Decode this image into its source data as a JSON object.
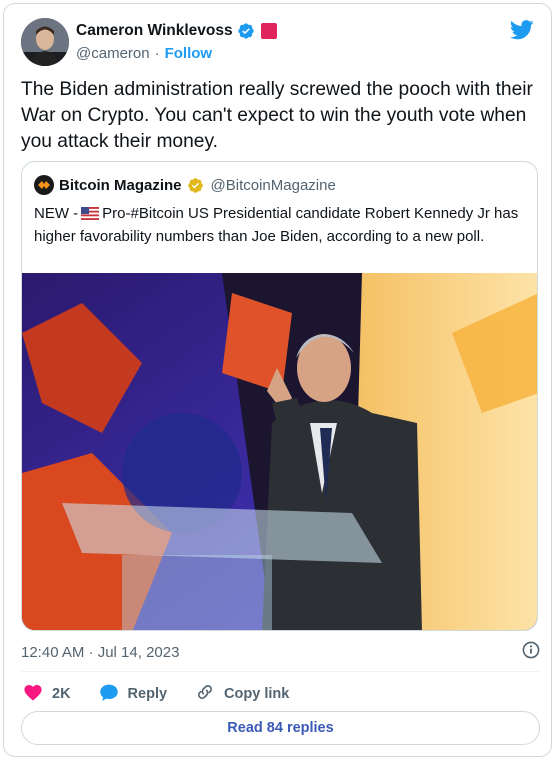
{
  "author": {
    "name": "Cameron Winklevoss",
    "handle": "@cameron",
    "separator": "·",
    "follow_label": "Follow",
    "verified_icon": "verified-badge-icon",
    "accent_color": "#1d9bf0"
  },
  "tweet": {
    "text": "The Biden administration really screwed the pooch with their War on Crypto. You can't expect to win the youth vote when you attack their money."
  },
  "quoted": {
    "name": "Bitcoin Magazine",
    "handle": "@BitcoinMagazine",
    "text_prefix": "NEW -",
    "text_body": "Pro-#Bitcoin US Presidential candidate Robert Kennedy Jr has higher favorability numbers than Joe Biden, according to a new poll.",
    "verified_icon": "gold-verified-badge-icon"
  },
  "meta": {
    "timestamp": "12:40 AM · Jul 14, 2023"
  },
  "actions": {
    "like_count": "2K",
    "reply_label": "Reply",
    "copy_label": "Copy link",
    "like_color": "#f91880",
    "reply_color": "#1d9bf0"
  },
  "footer": {
    "read_replies": "Read 84 replies"
  }
}
